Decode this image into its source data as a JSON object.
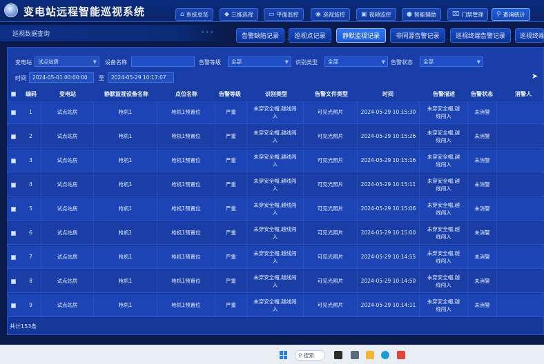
{
  "app": {
    "title": "变电站远程智能巡视系统"
  },
  "nav": [
    {
      "label": "系统总览",
      "icon": "home-icon"
    },
    {
      "label": "三维巡视",
      "icon": "cube-icon"
    },
    {
      "label": "平面监控",
      "icon": "monitor-icon"
    },
    {
      "label": "巡视监控",
      "icon": "eye-icon"
    },
    {
      "label": "视频监控",
      "icon": "video-icon"
    },
    {
      "label": "智能辅助",
      "icon": "bulb-icon"
    },
    {
      "label": "门禁管理",
      "icon": "door-icon"
    },
    {
      "label": "查询统计",
      "icon": "search-icon"
    }
  ],
  "breadcrumb": {
    "label": "巡视数据查询",
    "dots": "› › ›"
  },
  "tabs": [
    {
      "label": "告警缺陷记录"
    },
    {
      "label": "巡视点记录"
    },
    {
      "label": "静默监视记录"
    },
    {
      "label": "非同源告警记录"
    },
    {
      "label": "巡视终端告警记录"
    },
    {
      "label": "巡视终端"
    }
  ],
  "filters": {
    "station_label": "变电站",
    "station_value": "试点站房",
    "device_label": "设备名称",
    "device_value": "",
    "level_label": "告警等级",
    "level_value": "全部",
    "recog_label": "识别类型",
    "recog_value": "全部",
    "status_label": "告警状态",
    "status_value": "全部",
    "time_label": "时间",
    "time_start": "2024-05-01 00:00:00",
    "time_sep": "至",
    "time_end": "2024-05-29 10:17:07"
  },
  "table": {
    "headers": [
      "编码",
      "变电站",
      "静默监视设备名称",
      "点位名称",
      "告警等级",
      "识别类型",
      "告警文件类型",
      "时间",
      "告警描述",
      "告警状态",
      "消警人"
    ],
    "rows": [
      {
        "no": "1",
        "station": "试点站房",
        "device": "枪机1",
        "point": "枪机1预置位",
        "level": "严重",
        "recog": "未穿安全帽,越线闯入",
        "file": "可见光照片",
        "time": "2024-05-29 10:15:30",
        "desc": "未穿安全帽,越线闯入",
        "status": "未消警",
        "handler": ""
      },
      {
        "no": "2",
        "station": "试点站房",
        "device": "枪机1",
        "point": "枪机1预置位",
        "level": "严重",
        "recog": "未穿安全帽,越线闯入",
        "file": "可见光照片",
        "time": "2024-05-29 10:15:26",
        "desc": "未穿安全帽,越线闯入",
        "status": "未消警",
        "handler": ""
      },
      {
        "no": "3",
        "station": "试点站房",
        "device": "枪机1",
        "point": "枪机1预置位",
        "level": "严重",
        "recog": "未穿安全帽,越线闯入",
        "file": "可见光照片",
        "time": "2024-05-29 10:15:16",
        "desc": "未穿安全帽,越线闯入",
        "status": "未消警",
        "handler": ""
      },
      {
        "no": "4",
        "station": "试点站房",
        "device": "枪机1",
        "point": "枪机1预置位",
        "level": "严重",
        "recog": "未穿安全帽,越线闯入",
        "file": "可见光照片",
        "time": "2024-05-29 10:15:11",
        "desc": "未穿安全帽,越线闯入",
        "status": "未消警",
        "handler": ""
      },
      {
        "no": "5",
        "station": "试点站房",
        "device": "枪机1",
        "point": "枪机1预置位",
        "level": "严重",
        "recog": "未穿安全帽,越线闯入",
        "file": "可见光照片",
        "time": "2024-05-29 10:15:06",
        "desc": "未穿安全帽,越线闯入",
        "status": "未消警",
        "handler": ""
      },
      {
        "no": "6",
        "station": "试点站房",
        "device": "枪机1",
        "point": "枪机1预置位",
        "level": "严重",
        "recog": "未穿安全帽,越线闯入",
        "file": "可见光照片",
        "time": "2024-05-29 10:15:00",
        "desc": "未穿安全帽,越线闯入",
        "status": "未消警",
        "handler": ""
      },
      {
        "no": "7",
        "station": "试点站房",
        "device": "枪机1",
        "point": "枪机1预置位",
        "level": "严重",
        "recog": "未穿安全帽,越线闯入",
        "file": "可见光照片",
        "time": "2024-05-29 10:14:55",
        "desc": "未穿安全帽,越线闯入",
        "status": "未消警",
        "handler": ""
      },
      {
        "no": "8",
        "station": "试点站房",
        "device": "枪机1",
        "point": "枪机1预置位",
        "level": "严重",
        "recog": "未穿安全帽,越线闯入",
        "file": "可见光照片",
        "time": "2024-05-29 10:14:50",
        "desc": "未穿安全帽,越线闯入",
        "status": "未消警",
        "handler": ""
      },
      {
        "no": "9",
        "station": "试点站房",
        "device": "枪机1",
        "point": "枪机1预置位",
        "level": "严重",
        "recog": "未穿安全帽,越线闯入",
        "file": "可见光照片",
        "time": "2024-05-29 10:14:11",
        "desc": "未穿安全帽,越线闯入",
        "status": "未消警",
        "handler": ""
      }
    ]
  },
  "footer": {
    "total": "共计153条"
  },
  "taskbar": {
    "search_label": "搜索"
  },
  "colors": {
    "accent": "#1f58d6",
    "panel": "#1a3ea8",
    "background": "#0a1a4a"
  }
}
